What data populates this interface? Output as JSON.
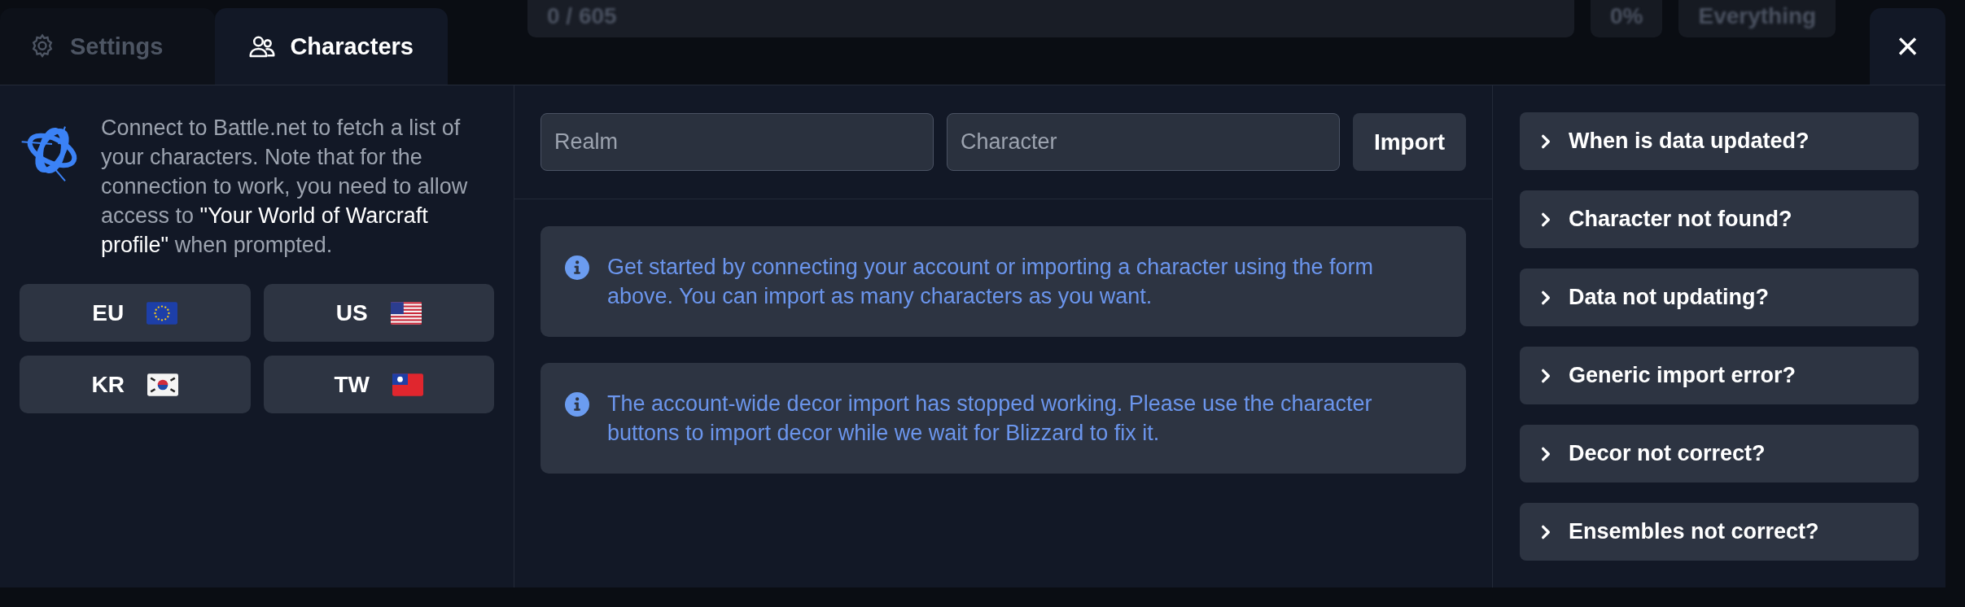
{
  "background": {
    "progress": "0 / 605",
    "percent": "0%",
    "filter": "Everything"
  },
  "tabs": [
    {
      "label": "Settings",
      "selected": false
    },
    {
      "label": "Characters",
      "selected": true
    }
  ],
  "close": "×",
  "connect": {
    "text": "Connect to Battle.net to fetch a list of your characters. Note that for the connection to work, you need to allow access to **\"Your World of Warcraft profile\"** when prompted.",
    "regions": [
      {
        "label": "EU"
      },
      {
        "label": "US"
      },
      {
        "label": "KR"
      },
      {
        "label": "TW"
      }
    ]
  },
  "import_form": {
    "realm": {
      "placeholder": "Realm"
    },
    "character": {
      "placeholder": "Character"
    },
    "button": "Import"
  },
  "messages": [
    "Get started by connecting your account or importing a character using the form above. You can import as many characters as you want.",
    "The account-wide decor import has stopped working. Please use the character buttons to import decor while we wait for Blizzard to fix it."
  ],
  "faq": [
    {
      "question": "When is data updated?",
      "expanded": false
    },
    {
      "question": "Character not found?",
      "expanded": false
    },
    {
      "question": "Data not updating?",
      "expanded": false
    },
    {
      "question": "Generic import error?",
      "expanded": false
    },
    {
      "question": "Decor not correct?",
      "expanded": false
    },
    {
      "question": "Ensembles not correct?",
      "expanded": false
    }
  ]
}
